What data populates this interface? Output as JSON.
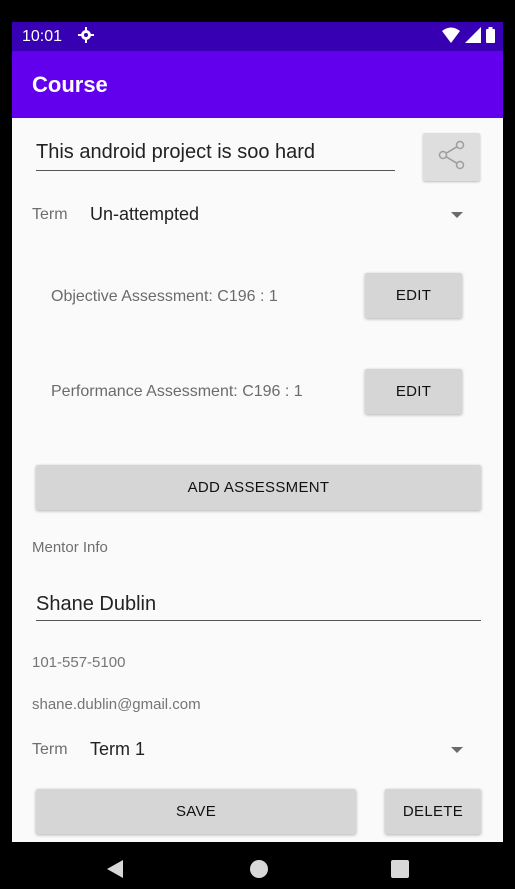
{
  "status_bar": {
    "time": "10:01",
    "icons": [
      "gear-icon",
      "wifi-icon",
      "signal-icon",
      "battery-icon"
    ]
  },
  "app_bar": {
    "title": "Course",
    "color": "#6200ee",
    "status_color": "#3700b3"
  },
  "course": {
    "title_value": "This android project is soo hard",
    "term_label": "Term",
    "status_value": "Un-attempted"
  },
  "assessments": [
    {
      "name": "Objective Assessment: C196 : 1",
      "edit_label": "EDIT"
    },
    {
      "name": "Performance Assessment: C196 : 1",
      "edit_label": "EDIT"
    }
  ],
  "add_assessment_label": "ADD ASSESSMENT",
  "mentor": {
    "section_label": "Mentor Info",
    "name": "Shane Dublin",
    "phone": "101-557-5100",
    "email": "shane.dublin@gmail.com"
  },
  "term": {
    "label": "Term",
    "value": "Term 1"
  },
  "actions": {
    "save_label": "SAVE",
    "delete_label": "DELETE"
  }
}
